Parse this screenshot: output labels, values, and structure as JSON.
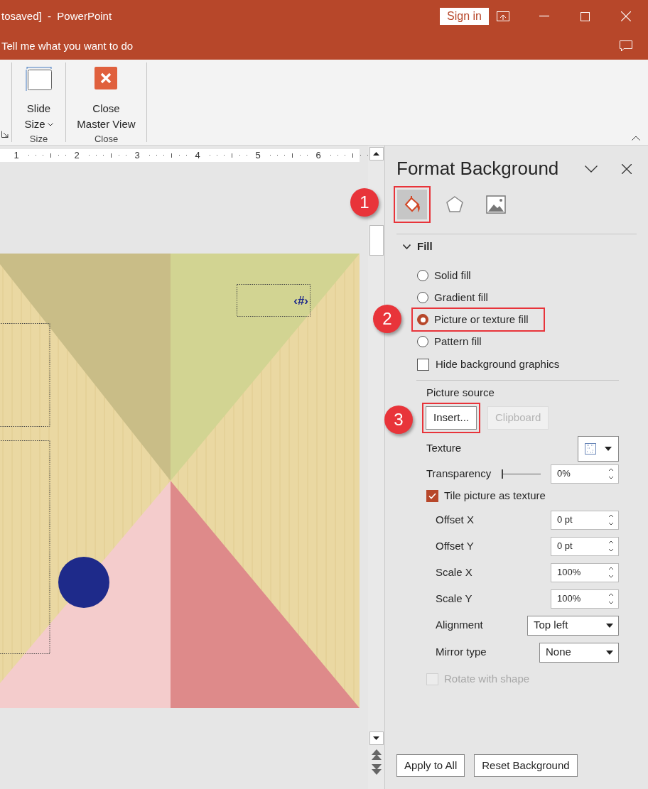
{
  "window": {
    "title": "tosaved]  -  PowerPoint",
    "sign_in": "Sign in"
  },
  "tell_me": {
    "placeholder": "Tell me what you want to do"
  },
  "ribbon": {
    "groups": [
      {
        "label": "Size",
        "button": {
          "kind": "slide-size",
          "lines": [
            "Slide",
            "Size"
          ]
        }
      },
      {
        "label": "Close",
        "button": {
          "kind": "close",
          "lines": [
            "Close",
            "Master View"
          ]
        }
      }
    ]
  },
  "ruler": {
    "marks": [
      "1",
      "2",
      "3",
      "4",
      "5",
      "6"
    ]
  },
  "slide": {
    "placeholder_text": "‹#›"
  },
  "panel": {
    "title": "Format Background",
    "tabs": [
      {
        "kind": "fill",
        "selected": true,
        "highlighted": true
      },
      {
        "kind": "effects",
        "selected": false,
        "highlighted": false
      },
      {
        "kind": "picture",
        "selected": false,
        "highlighted": false
      }
    ],
    "section": {
      "title": "Fill",
      "expanded": true
    },
    "fill_options": [
      {
        "label": "Solid fill",
        "selected": false,
        "highlighted": false
      },
      {
        "label": "Gradient fill",
        "selected": false,
        "highlighted": false
      },
      {
        "label": "Picture or texture fill",
        "selected": true,
        "highlighted": true
      },
      {
        "label": "Pattern fill",
        "selected": false,
        "highlighted": false
      }
    ],
    "hide_background_graphics": {
      "label": "Hide background graphics",
      "checked": false
    },
    "picture_source": {
      "label": "Picture source",
      "buttons": [
        {
          "label": "Insert...",
          "disabled": false,
          "highlighted": true
        },
        {
          "label": "Clipboard",
          "disabled": true,
          "highlighted": false
        }
      ]
    },
    "texture": {
      "label": "Texture"
    },
    "transparency": {
      "label": "Transparency",
      "level": 0,
      "value": "0%"
    },
    "tile": {
      "label": "Tile picture as texture",
      "checked": true
    },
    "tile_fields": [
      {
        "label": "Offset X",
        "value": "0 pt"
      },
      {
        "label": "Offset Y",
        "value": "0 pt"
      },
      {
        "label": "Scale X",
        "value": "100%"
      },
      {
        "label": "Scale Y",
        "value": "100%"
      }
    ],
    "selects": [
      {
        "label": "Alignment",
        "value": "Top left"
      },
      {
        "label": "Mirror type",
        "value": "None"
      }
    ],
    "rotate_with_shape": {
      "label": "Rotate with shape",
      "checked": false,
      "disabled": true
    },
    "footer_buttons": [
      "Apply to All",
      "Reset Background"
    ]
  },
  "annotations": [
    {
      "number": "1"
    },
    {
      "number": "2"
    },
    {
      "number": "3"
    }
  ]
}
